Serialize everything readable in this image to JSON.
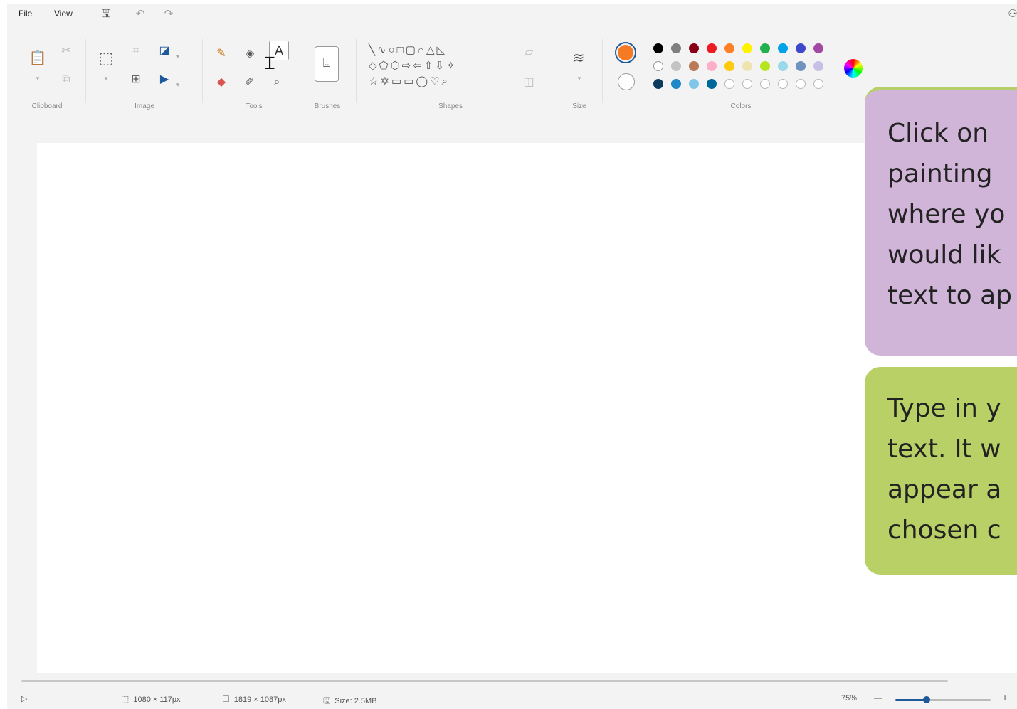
{
  "menu": {
    "file": "File",
    "view": "View"
  },
  "quick_access": [
    {
      "name": "save-icon",
      "glyph": "🖫"
    },
    {
      "name": "undo-icon",
      "glyph": "↶"
    },
    {
      "name": "redo-icon",
      "glyph": "↷"
    }
  ],
  "ribbon": {
    "groups": {
      "clipboard": "Clipboard",
      "image": "Image",
      "tools": "Tools",
      "brushes": "Brushes",
      "shapes": "Shapes",
      "size": "Size",
      "colors": "Colors"
    },
    "text_tool_label": "A",
    "shapes_rows": [
      "╲∿○□▢⌂△◺",
      "◇⬠⬡⇨⇦⇧⇩✧",
      "☆✡▭▭◯♡⌕"
    ]
  },
  "colors": {
    "primary": "#f47a24",
    "secondary": "#ffffff",
    "palette_row1": [
      "#000000",
      "#7f7f7f",
      "#880015",
      "#ed1c24",
      "#ff7f27",
      "#fff200",
      "#22b14c",
      "#00a2e8",
      "#3f48cc",
      "#a349a4"
    ],
    "palette_row2": [
      "#ffffff",
      "#c3c3c3",
      "#b97a57",
      "#ffaec9",
      "#ffc90e",
      "#efe4b0",
      "#b5e61d",
      "#99d9ea",
      "#7092be",
      "#c8bfe7"
    ],
    "palette_row3": [
      "#0b3b5c",
      "#1e88c8",
      "#7fc6e8",
      "#00679a",
      "",
      "",
      "",
      "",
      "",
      ""
    ]
  },
  "status": {
    "selection": "1080 × 117px",
    "canvas_size": "1819 × 1087px",
    "file_size": "Size: 2.5MB",
    "zoom": "75%",
    "zoom_minus": "—",
    "zoom_plus": "+",
    "zoom_level": 0.33
  },
  "callouts": {
    "purple_lines": [
      "Click on",
      "painting",
      "where yo",
      "would lik",
      "text to ap"
    ],
    "green_lines": [
      "Type in y",
      "text. It w",
      "appear a",
      "chosen c"
    ]
  }
}
